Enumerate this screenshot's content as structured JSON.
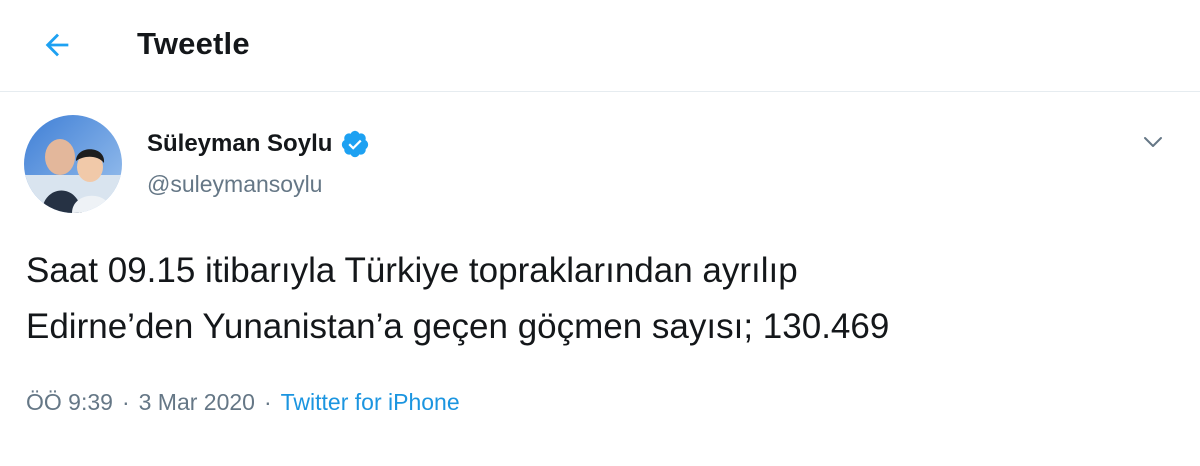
{
  "header": {
    "back_icon": "arrow-left-icon",
    "title": "Tweetle"
  },
  "tweet": {
    "author": {
      "name": "Süleyman Soylu",
      "handle": "@suleymansoylu",
      "verified_icon": "verified-badge-icon",
      "avatar_icon": "profile-photo"
    },
    "menu_icon": "chevron-down-icon",
    "text_lines": [
      "Saat 09.15 itibarıyla Türkiye topraklarından ayrılıp",
      "Edirne’den Yunanistan’a geçen göçmen sayısı; 130.469"
    ],
    "time": "ÖÖ 9:39",
    "separator": "·",
    "date": "3 Mar 2020",
    "source": "Twitter for iPhone"
  },
  "colors": {
    "accent": "#1da1f2",
    "link": "#1b95e0",
    "secondary_text": "#657786",
    "primary_text": "#14171a",
    "border": "#e6ecf0"
  }
}
